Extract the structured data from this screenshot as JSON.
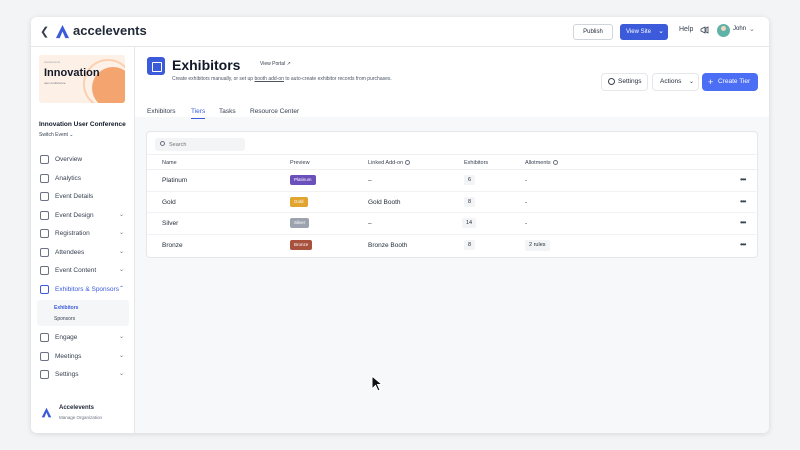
{
  "topbar": {
    "brand": "accelevents",
    "publish_label": "Publish",
    "view_site_label": "View Site",
    "help_label": "Help",
    "user_name": "John"
  },
  "sidebar": {
    "event_card": {
      "brand": "Accelevents",
      "title": "Innovation",
      "subtitle": "user conference"
    },
    "event_name": "Innovation User Conference",
    "switch_event": "Switch Event",
    "nav": [
      {
        "label": "Overview",
        "icon": "home-icon",
        "chevron": false
      },
      {
        "label": "Analytics",
        "icon": "analytics-icon",
        "chevron": false
      },
      {
        "label": "Event Details",
        "icon": "clipboard-icon",
        "chevron": false
      },
      {
        "label": "Event Design",
        "icon": "design-icon",
        "chevron": true
      },
      {
        "label": "Registration",
        "icon": "ticket-icon",
        "chevron": true
      },
      {
        "label": "Attendees",
        "icon": "people-icon",
        "chevron": true
      },
      {
        "label": "Event Content",
        "icon": "folder-icon",
        "chevron": true
      },
      {
        "label": "Exhibitors & Sponsors",
        "icon": "store-icon",
        "chevron": true,
        "active": true
      },
      {
        "label": "Engage",
        "icon": "grid-icon",
        "chevron": true
      },
      {
        "label": "Meetings",
        "icon": "meetings-icon",
        "chevron": true
      },
      {
        "label": "Settings",
        "icon": "gear-icon",
        "chevron": true
      }
    ],
    "subnav": [
      {
        "label": "Exhibitors",
        "active": true
      },
      {
        "label": "Sponsors",
        "active": false
      }
    ],
    "org_name": "Accelevents",
    "org_sub": "Manage Organization"
  },
  "main": {
    "title": "Exhibitors",
    "view_portal": "View Portal",
    "description_pre": "Create exhibitors manually, or set up ",
    "description_link": "booth add-on",
    "description_post": " to auto-create exhibitor records from purchases.",
    "settings_label": "Settings",
    "actions_label": "Actions",
    "create_label": "Create Tier",
    "tabs": [
      {
        "label": "Exhibitors",
        "active": false
      },
      {
        "label": "Tiers",
        "active": true
      },
      {
        "label": "Tasks",
        "active": false
      },
      {
        "label": "Resource Center",
        "active": false
      }
    ],
    "search_placeholder": "Search",
    "columns": [
      "Name",
      "Preview",
      "Linked Add-on",
      "Exhibitors",
      "Allotments"
    ],
    "rows": [
      {
        "name": "Platinum",
        "preview": "Platinum",
        "color": "#6b4fbb",
        "addon": "–",
        "exhibitors": "6",
        "allotments": "-",
        "rules": false
      },
      {
        "name": "Gold",
        "preview": "Gold",
        "color": "#e0a42f",
        "addon": "Gold Booth",
        "exhibitors": "8",
        "allotments": "-",
        "rules": false
      },
      {
        "name": "Silver",
        "preview": "Silver",
        "color": "#9ca3af",
        "addon": "–",
        "exhibitors": "14",
        "allotments": "-",
        "rules": false
      },
      {
        "name": "Bronze",
        "preview": "Bronze",
        "color": "#a8523e",
        "addon": "Bronze Booth",
        "exhibitors": "8",
        "allotments": "2 rules",
        "rules": true
      }
    ]
  }
}
